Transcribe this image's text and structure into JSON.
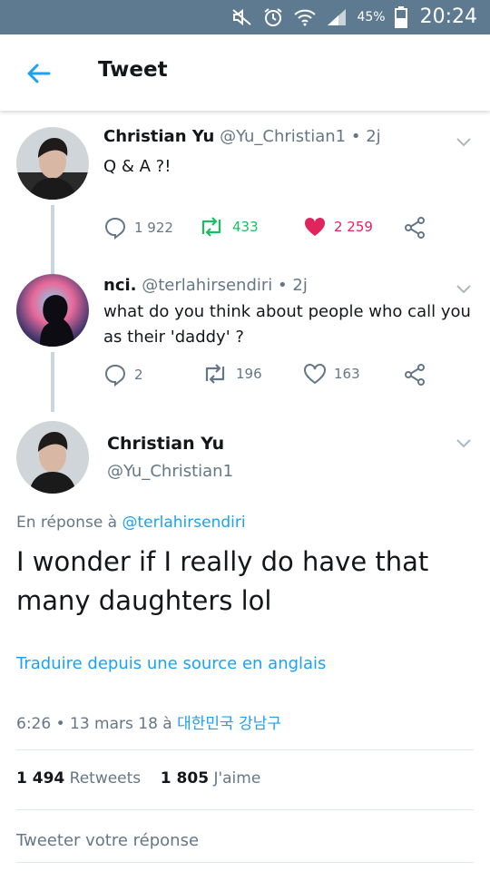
{
  "status_bar": {
    "battery_percent": "45%",
    "time": "20:24",
    "icons": [
      "mute-icon",
      "alarm-icon",
      "wifi-icon",
      "signal-icon",
      "battery-icon"
    ]
  },
  "header": {
    "title": "Tweet"
  },
  "tweets": [
    {
      "name": "Christian Yu",
      "handle": "@Yu_Christian1",
      "sep": "•",
      "time": "2j",
      "text": "Q & A ?!",
      "replies": "1 922",
      "retweets": "433",
      "likes": "2 259",
      "liked": true
    },
    {
      "name": "nci.",
      "handle": "@terlahirsendiri",
      "sep": "•",
      "time": "2j",
      "text": "what do you think about people who call you as their 'daddy' ?",
      "replies": "2",
      "retweets": "196",
      "likes": "163",
      "liked": false
    }
  ],
  "main_tweet": {
    "name": "Christian Yu",
    "handle": "@Yu_Christian1",
    "reply_prefix": "En réponse à",
    "reply_to": "@terlahirsendiri",
    "text": "I wonder if I really do have that many daughters lol",
    "translate": "Traduire depuis une source en anglais",
    "date": "6:26 • 13 mars 18 à",
    "location": "대한민국 강남구",
    "retweets_count": "1 494",
    "retweets_label": "Retweets",
    "likes_count": "1 805",
    "likes_label": "J'aime",
    "reply_placeholder": "Tweeter votre réponse"
  },
  "colors": {
    "status_bar": "#5d7a90",
    "accent": "#1da1f2",
    "retweet": "#17bf63",
    "like": "#e0245e",
    "muted": "#657786"
  }
}
